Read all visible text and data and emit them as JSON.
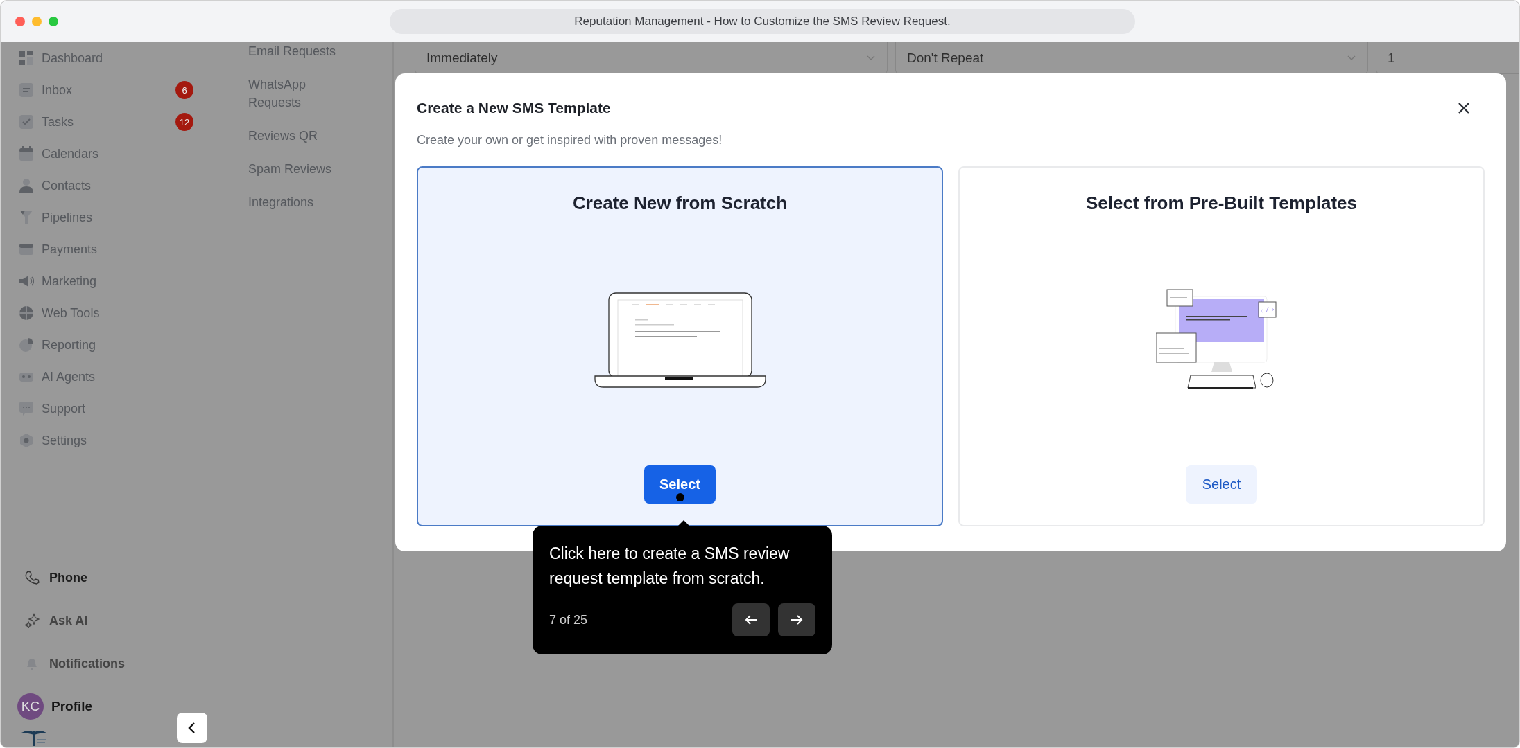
{
  "window": {
    "title": "Reputation Management - How to Customize the SMS Review Request."
  },
  "sidebar": {
    "items": [
      {
        "label": "Dashboard"
      },
      {
        "label": "Inbox",
        "badge": "6"
      },
      {
        "label": "Tasks",
        "badge": "12"
      },
      {
        "label": "Calendars"
      },
      {
        "label": "Contacts"
      },
      {
        "label": "Pipelines"
      },
      {
        "label": "Payments"
      },
      {
        "label": "Marketing"
      },
      {
        "label": "Web Tools"
      },
      {
        "label": "Reporting"
      },
      {
        "label": "AI Agents"
      },
      {
        "label": "Support"
      },
      {
        "label": "Settings"
      }
    ],
    "bottom_items": [
      {
        "label": "Phone"
      },
      {
        "label": "Ask AI"
      },
      {
        "label": "Notifications"
      }
    ],
    "profile": {
      "initials": "KC",
      "label": "Profile"
    }
  },
  "subnav": {
    "items": [
      "Email Requests",
      "WhatsApp Requests",
      "Reviews QR",
      "Spam Reviews",
      "Integrations"
    ]
  },
  "form": {
    "fields": [
      {
        "kind": "select",
        "value": "Immediately"
      },
      {
        "kind": "select",
        "value": "Don't Repeat"
      },
      {
        "kind": "input",
        "placeholder": "1"
      }
    ]
  },
  "modal": {
    "title": "Create a New SMS Template",
    "subtitle": "Create your own or get inspired with proven messages!",
    "options": [
      {
        "title": "Create New from Scratch",
        "button": "Select",
        "selected": true
      },
      {
        "title": "Select from Pre-Built Templates",
        "button": "Select",
        "selected": false
      }
    ]
  },
  "tour": {
    "text": "Click here to create a SMS review request template from scratch.",
    "progress": "7 of 25"
  }
}
